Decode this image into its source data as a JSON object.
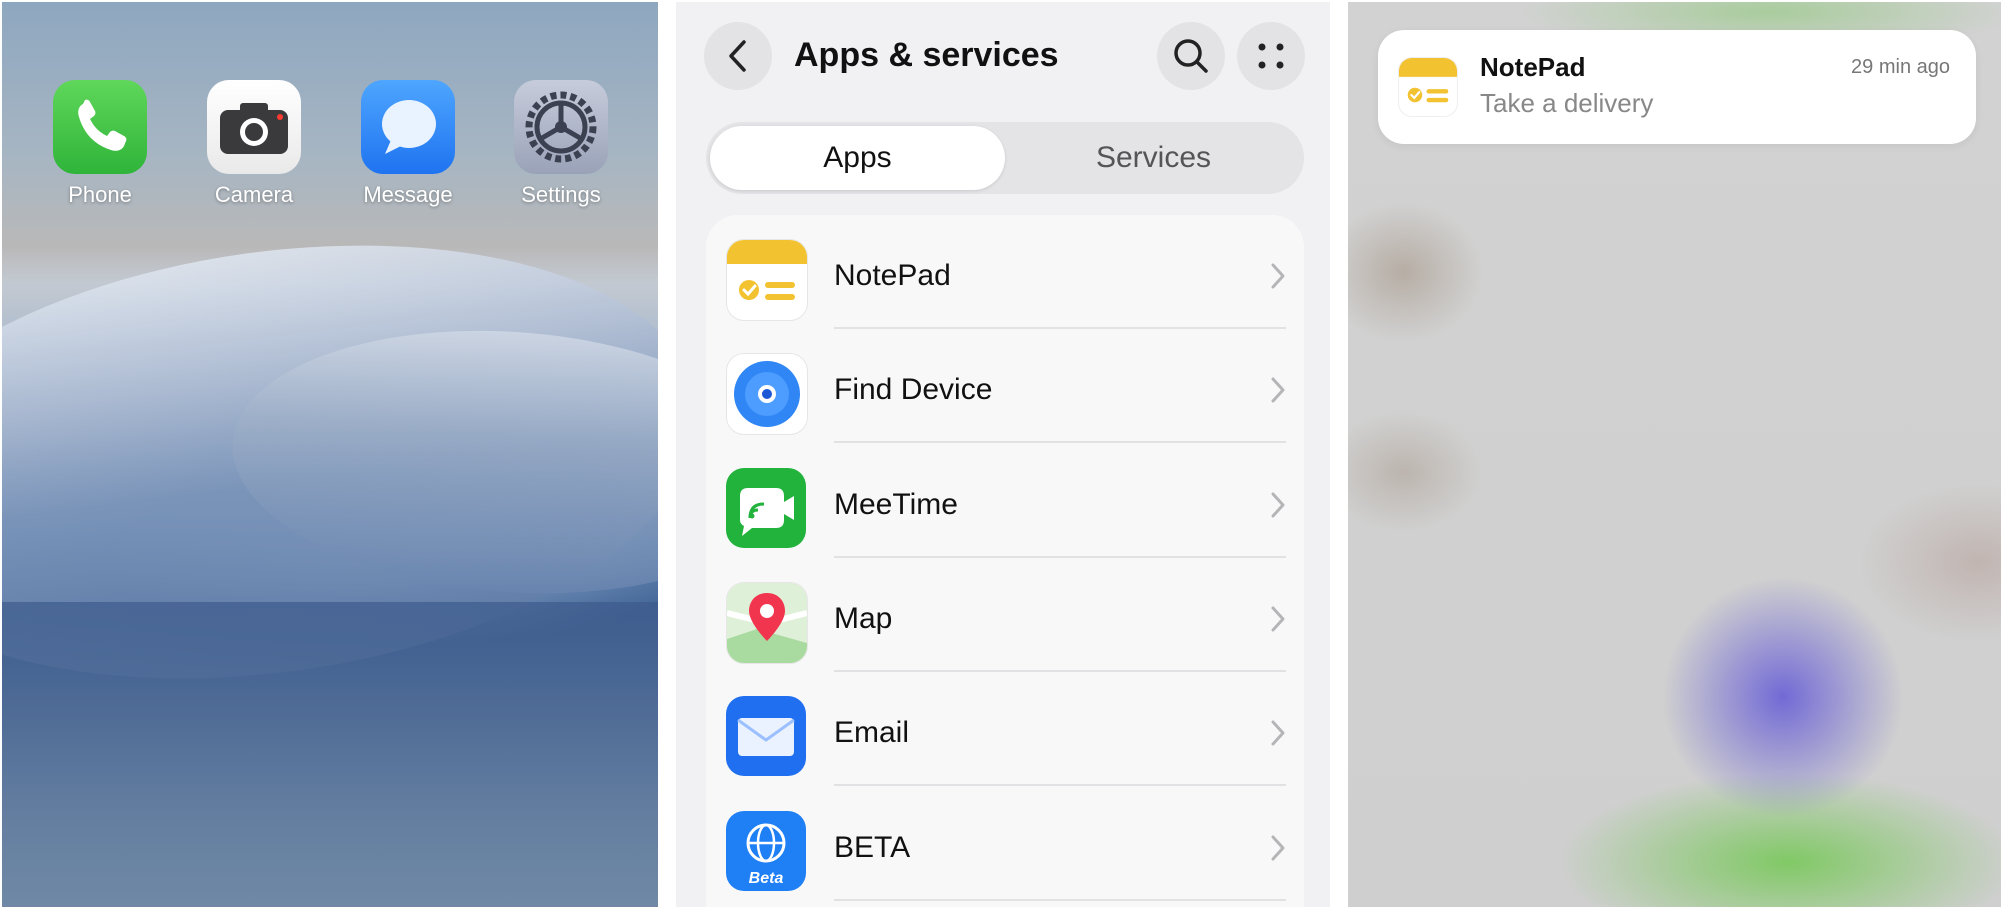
{
  "home": {
    "apps": [
      {
        "label": "Phone",
        "icon": "phone-icon"
      },
      {
        "label": "Camera",
        "icon": "camera-icon"
      },
      {
        "label": "Message",
        "icon": "message-icon"
      },
      {
        "label": "Settings",
        "icon": "settings-gear-icon"
      }
    ]
  },
  "apps_services": {
    "title": "Apps & services",
    "tabs": [
      {
        "label": "Apps",
        "selected": true
      },
      {
        "label": "Services",
        "selected": false
      }
    ],
    "items": [
      {
        "label": "NotePad",
        "icon": "notepad-icon"
      },
      {
        "label": "Find Device",
        "icon": "find-device-icon"
      },
      {
        "label": "MeeTime",
        "icon": "meetime-icon"
      },
      {
        "label": "Map",
        "icon": "map-pin-icon"
      },
      {
        "label": "Email",
        "icon": "envelope-icon"
      },
      {
        "label": "BETA",
        "icon": "beta-globe-icon",
        "icon_text": "Beta"
      }
    ]
  },
  "notification": {
    "app": "NotePad",
    "time": "29 min ago",
    "text": "Take a delivery"
  },
  "colors": {
    "notepad_yellow": "#F2C230",
    "phone_green": "#3DBE45",
    "message_blue": "#2C83F5",
    "meetime_green": "#21B33C",
    "email_blue": "#1F6FF0",
    "map_red": "#F2354E"
  }
}
